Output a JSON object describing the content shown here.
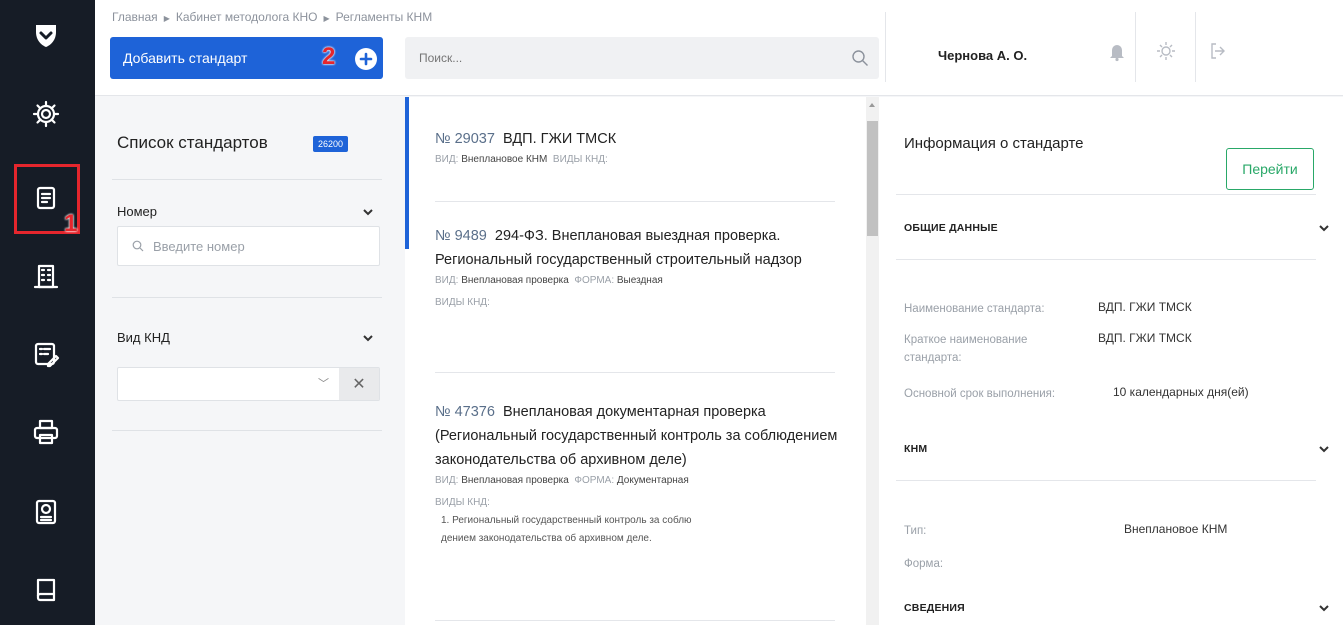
{
  "breadcrumb": [
    "Главная",
    "Кабинет методолога КНО",
    "Регламенты КНМ"
  ],
  "toolbar": {
    "add_label": "Добавить стандарт",
    "search_placeholder": "Поиск..."
  },
  "user": {
    "name": "Чернова А. О."
  },
  "annotations": {
    "marker1": "1",
    "marker2": "2"
  },
  "sidebar": {
    "icons": [
      "logo-shield-icon",
      "settings-gear-icon",
      "documents-icon",
      "building-icon",
      "checklist-edit-icon",
      "printer-icon",
      "certificate-icon",
      "book-icon"
    ]
  },
  "filters": {
    "title": "Список стандартов",
    "count": "26200",
    "number_label": "Номер",
    "number_placeholder": "Введите номер",
    "vid_label": "Вид КНД"
  },
  "list": [
    {
      "num": "№ 29037",
      "title": "ВДП. ГЖИ ТМСК",
      "meta1_label": "ВИД:",
      "meta1_value": "Внеплановое КНМ",
      "meta1_extra": "ВИДЫ КНД:"
    },
    {
      "num": "№ 9489",
      "title": "294-ФЗ. Внеплановая выездная проверка. Региональный государственный строительный надзор",
      "meta1_label": "ВИД:",
      "meta1_value": "Внеплановая проверка",
      "meta1_form_label": "ФОРМА:",
      "meta1_form_value": "Выездная",
      "meta2": "ВИДЫ КНД:"
    },
    {
      "num": "№ 47376",
      "title": "Внеплановая документарная проверка (Региональный государственный контроль за соблюдением законодательства об архивном деле)",
      "meta1_label": "ВИД:",
      "meta1_value": "Внеплановая проверка",
      "meta1_form_label": "ФОРМА:",
      "meta1_form_value": "Документарная",
      "meta2": "ВИДЫ КНД:",
      "kinds": [
        "1. Региональный государственный контроль за соблю",
        "дением законодательства об архивном деле."
      ]
    }
  ],
  "info": {
    "title": "Информация о стандарте",
    "go_label": "Перейти",
    "section_general": "ОБЩИЕ ДАННЫЕ",
    "name_label": "Наименование стандарта:",
    "name_value": "ВДП. ГЖИ ТМСК",
    "short_label_1": "Краткое наименование",
    "short_label_2": "стандарта:",
    "short_value": "ВДП. ГЖИ ТМСК",
    "term_label": "Основной срок выполнения:",
    "term_value": "10 календарных дня(ей)",
    "section_knm": "КНМ",
    "type_label": "Тип:",
    "type_value": "Внеплановое КНМ",
    "form_label": "Форма:",
    "section_info": "СВЕДЕНИЯ"
  }
}
